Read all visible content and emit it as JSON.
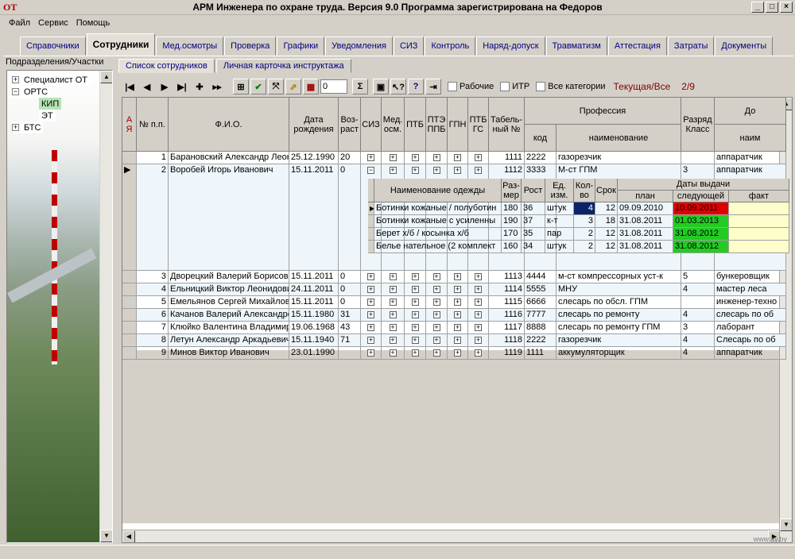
{
  "window": {
    "logo": "ОТ",
    "title": "АРМ Инженера по охране труда. Версия 9.0 Программа зарегистрирована на  Федоров"
  },
  "menu": [
    "Файл",
    "Сервис",
    "Помощь"
  ],
  "tabs": [
    "Справочники",
    "Сотрудники",
    "Мед.осмотры",
    "Проверка",
    "Графики",
    "Уведомления",
    "СИЗ",
    "Контроль",
    "Наряд-допуск",
    "Травматизм",
    "Аттестация",
    "Затраты",
    "Документы"
  ],
  "active_tab": "Сотрудники",
  "left": {
    "header": "Подразделения/Участки",
    "tree": [
      {
        "label": "Специалист ОТ",
        "exp": "+"
      },
      {
        "label": "ОРТС",
        "exp": "−"
      },
      {
        "label": "КИП",
        "exp": ""
      },
      {
        "label": "ЭТ",
        "exp": ""
      },
      {
        "label": "БТС",
        "exp": "+"
      }
    ]
  },
  "subtabs": [
    "Список сотрудников",
    "Личная карточка инструктажа"
  ],
  "toolbar": {
    "spin_value": "0",
    "sigma": "Σ",
    "cb_workers": "Рабочие",
    "cb_itr": "ИТР",
    "cb_all": "Все категории",
    "status": "Текущая/Все",
    "count": "2/9"
  },
  "headers": {
    "sort": "А Я",
    "num": "№ п.п.",
    "fio": "Ф.И.О.",
    "dob": "Дата рождения",
    "age": "Воз- раст",
    "siz": "СИЗ",
    "med": "Мед. осм.",
    "ptb": "ПТБ",
    "pte": "ПТЭ ППБ",
    "gpn": "ГПН",
    "ptbgs": "ПТБ ГС",
    "tab": "Табель- ный №",
    "prof": "Профессия",
    "prof_code": "код",
    "prof_name": "наименование",
    "grade": "Разряд Класс",
    "pos": "До",
    "pos_sub": "наим"
  },
  "employees": [
    {
      "n": "1",
      "fio": "Барановский Александр Леон",
      "dob": "25.12.1990",
      "age": "20",
      "tab": "1111",
      "code": "2222",
      "prof": "газорезчик",
      "grade": "",
      "pos": "аппаратчик"
    },
    {
      "n": "2",
      "fio": "Воробей Игорь Иванович",
      "dob": "15.11.2011",
      "age": "0",
      "tab": "1112",
      "code": "3333",
      "prof": "М-ст ГПМ",
      "grade": "3",
      "pos": "аппаратчик"
    },
    {
      "n": "3",
      "fio": "Дворецкий Валерий Борисови",
      "dob": "15.11.2011",
      "age": "0",
      "tab": "1113",
      "code": "4444",
      "prof": "м-ст компрессорных уст-к",
      "grade": "5",
      "pos": "бункеровщик"
    },
    {
      "n": "4",
      "fio": "Ельницкий Виктор Леонидови",
      "dob": "24.11.2011",
      "age": "0",
      "tab": "1114",
      "code": "5555",
      "prof": "МНУ",
      "grade": "4",
      "pos": "мастер леса"
    },
    {
      "n": "5",
      "fio": "Емельянов Сергей Михайлови",
      "dob": "15.11.2011",
      "age": "0",
      "tab": "1115",
      "code": "6666",
      "prof": "слесарь по обсл. ГПМ",
      "grade": "",
      "pos": "инженер-техно"
    },
    {
      "n": "6",
      "fio": "Качанов Валерий Александро",
      "dob": "15.11.1980",
      "age": "31",
      "tab": "1116",
      "code": "7777",
      "prof": "слесарь по ремонту",
      "grade": "4",
      "pos": "слесарь по об"
    },
    {
      "n": "7",
      "fio": "Клюйко Валентина Владимиро",
      "dob": "19.06.1968",
      "age": "43",
      "tab": "1117",
      "code": "8888",
      "prof": "слесарь по ремонту ГПМ",
      "grade": "3",
      "pos": "лаборант"
    },
    {
      "n": "8",
      "fio": "Летун Александр Аркадьевич",
      "dob": "15.11.1940",
      "age": "71",
      "tab": "1118",
      "code": "2222",
      "prof": "газорезчик",
      "grade": "4",
      "pos": "Слесарь по об"
    },
    {
      "n": "9",
      "fio": "Минов Виктор Иванович",
      "dob": "23.01.1990",
      "age": "",
      "tab": "1119",
      "code": "1111",
      "prof": "аккумуляторщик",
      "grade": "4",
      "pos": "аппаратчик"
    }
  ],
  "siz_headers": {
    "name": "Наименование одежды",
    "size": "Раз- мер",
    "height": "Рост",
    "unit": "Ед. изм.",
    "qty": "Кол- во",
    "term": "Срок",
    "dates": "Даты выдачи",
    "plan": "план",
    "next": "следующей",
    "fact": "факт"
  },
  "siz_items": [
    {
      "name": "Ботинки кожаные / полуботин",
      "size": "180",
      "height": "36",
      "unit": "штук",
      "qty": "4",
      "term": "12",
      "plan": "09.09.2010",
      "next": "10.09.2011",
      "status": "red"
    },
    {
      "name": "Ботинки кожаные с усиленны",
      "size": "190",
      "height": "37",
      "unit": "к-т",
      "qty": "3",
      "term": "18",
      "plan": "31.08.2011",
      "next": "01.03.2013",
      "status": "green"
    },
    {
      "name": "Берет х/б / косынка х/б",
      "size": "170",
      "height": "35",
      "unit": "пар",
      "qty": "2",
      "term": "12",
      "plan": "31.08.2011",
      "next": "31.08.2012",
      "status": "green"
    },
    {
      "name": "Белье нательное (2 комплект",
      "size": "160",
      "height": "34",
      "unit": "штук",
      "qty": "2",
      "term": "12",
      "plan": "31.08.2011",
      "next": "31.08.2012",
      "status": "green"
    }
  ],
  "colors": {
    "expired": "#e00000",
    "valid": "#22cc22",
    "selected": "#0a246a"
  },
  "watermark": "www.ay.by"
}
